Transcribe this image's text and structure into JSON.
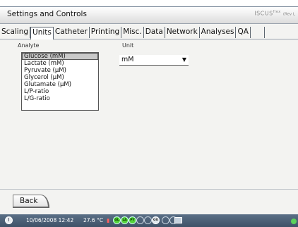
{
  "window": {
    "title": "Settings and Controls",
    "brand": "ISCUS",
    "brand_flex": "flex",
    "brand_rev": "(Rev L"
  },
  "tabs": [
    "Scaling",
    "Units",
    "Catheter",
    "Printing",
    "Misc.",
    "Data",
    "Network",
    "Analyses",
    "QA"
  ],
  "active_tab": "Units",
  "analyte": {
    "label": "Analyte",
    "items": [
      "Glucose (mM)",
      "Lactate (mM)",
      "Pyruvate (µM)",
      "Glycerol (µM)",
      "Glutamate (µM)",
      "L/P-ratio",
      "L/G-ratio"
    ],
    "selected": "Glucose (mM)"
  },
  "unit": {
    "label": "Unit",
    "value": "mM",
    "arrow": "▼"
  },
  "footer": {
    "back_label": "Back"
  },
  "status": {
    "datetime": "10/06/2008 12:42",
    "temperature": "27.6 °C",
    "samples": [
      "GL",
      "LA",
      "PY",
      "",
      "",
      "GU",
      "",
      ""
    ],
    "accent_green": "#54d23a",
    "bar_color": "#4b5f75"
  }
}
